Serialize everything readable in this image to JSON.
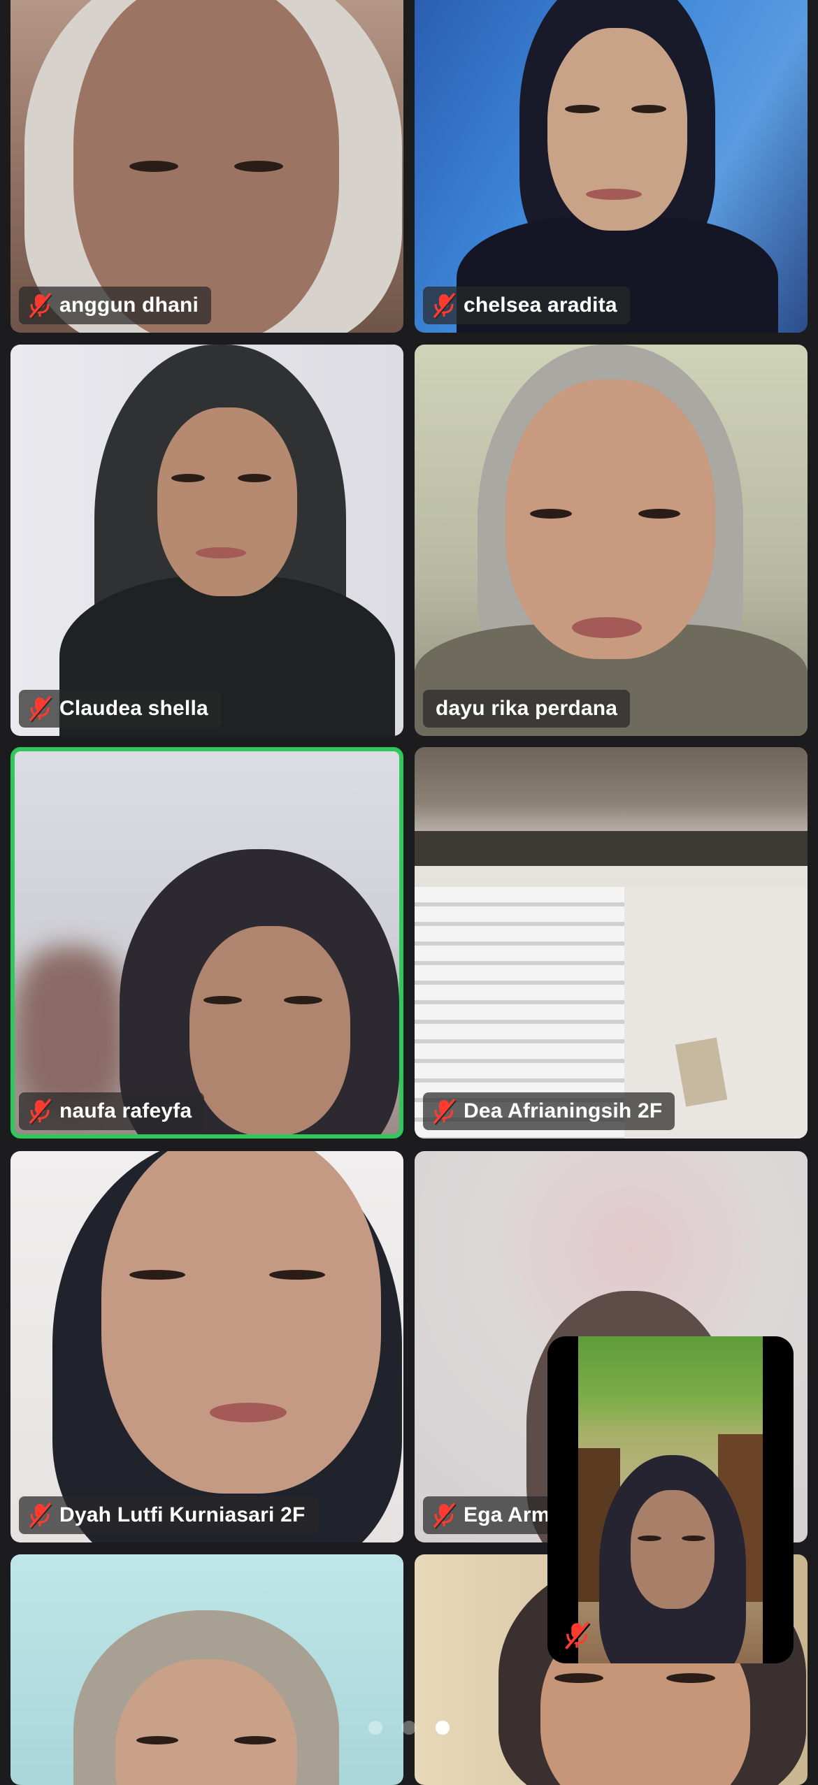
{
  "participants": [
    {
      "name": "anggun dhani",
      "muted": true
    },
    {
      "name": "chelsea aradita",
      "muted": true
    },
    {
      "name": "Claudea shella",
      "muted": true
    },
    {
      "name": "dayu rika perdana",
      "muted": false
    },
    {
      "name": "naufa rafeyfa",
      "muted": true,
      "active_speaker": true
    },
    {
      "name": "Dea Afrianingsih 2F",
      "muted": true
    },
    {
      "name": "Dyah Lutfi Kurniasari 2F",
      "muted": true
    },
    {
      "name": "Ega Arm",
      "muted": true
    },
    {
      "name": "",
      "muted": false
    },
    {
      "name": "",
      "muted": false
    }
  ],
  "self_view": {
    "muted": true
  },
  "pagination": {
    "pages": 3,
    "current": 3
  },
  "colors": {
    "active_speaker_border": "#2fc85a",
    "muted_icon": "#ff3b30",
    "background": "#1c1c1e"
  },
  "icons": {
    "muted": "mic-slash-icon"
  }
}
